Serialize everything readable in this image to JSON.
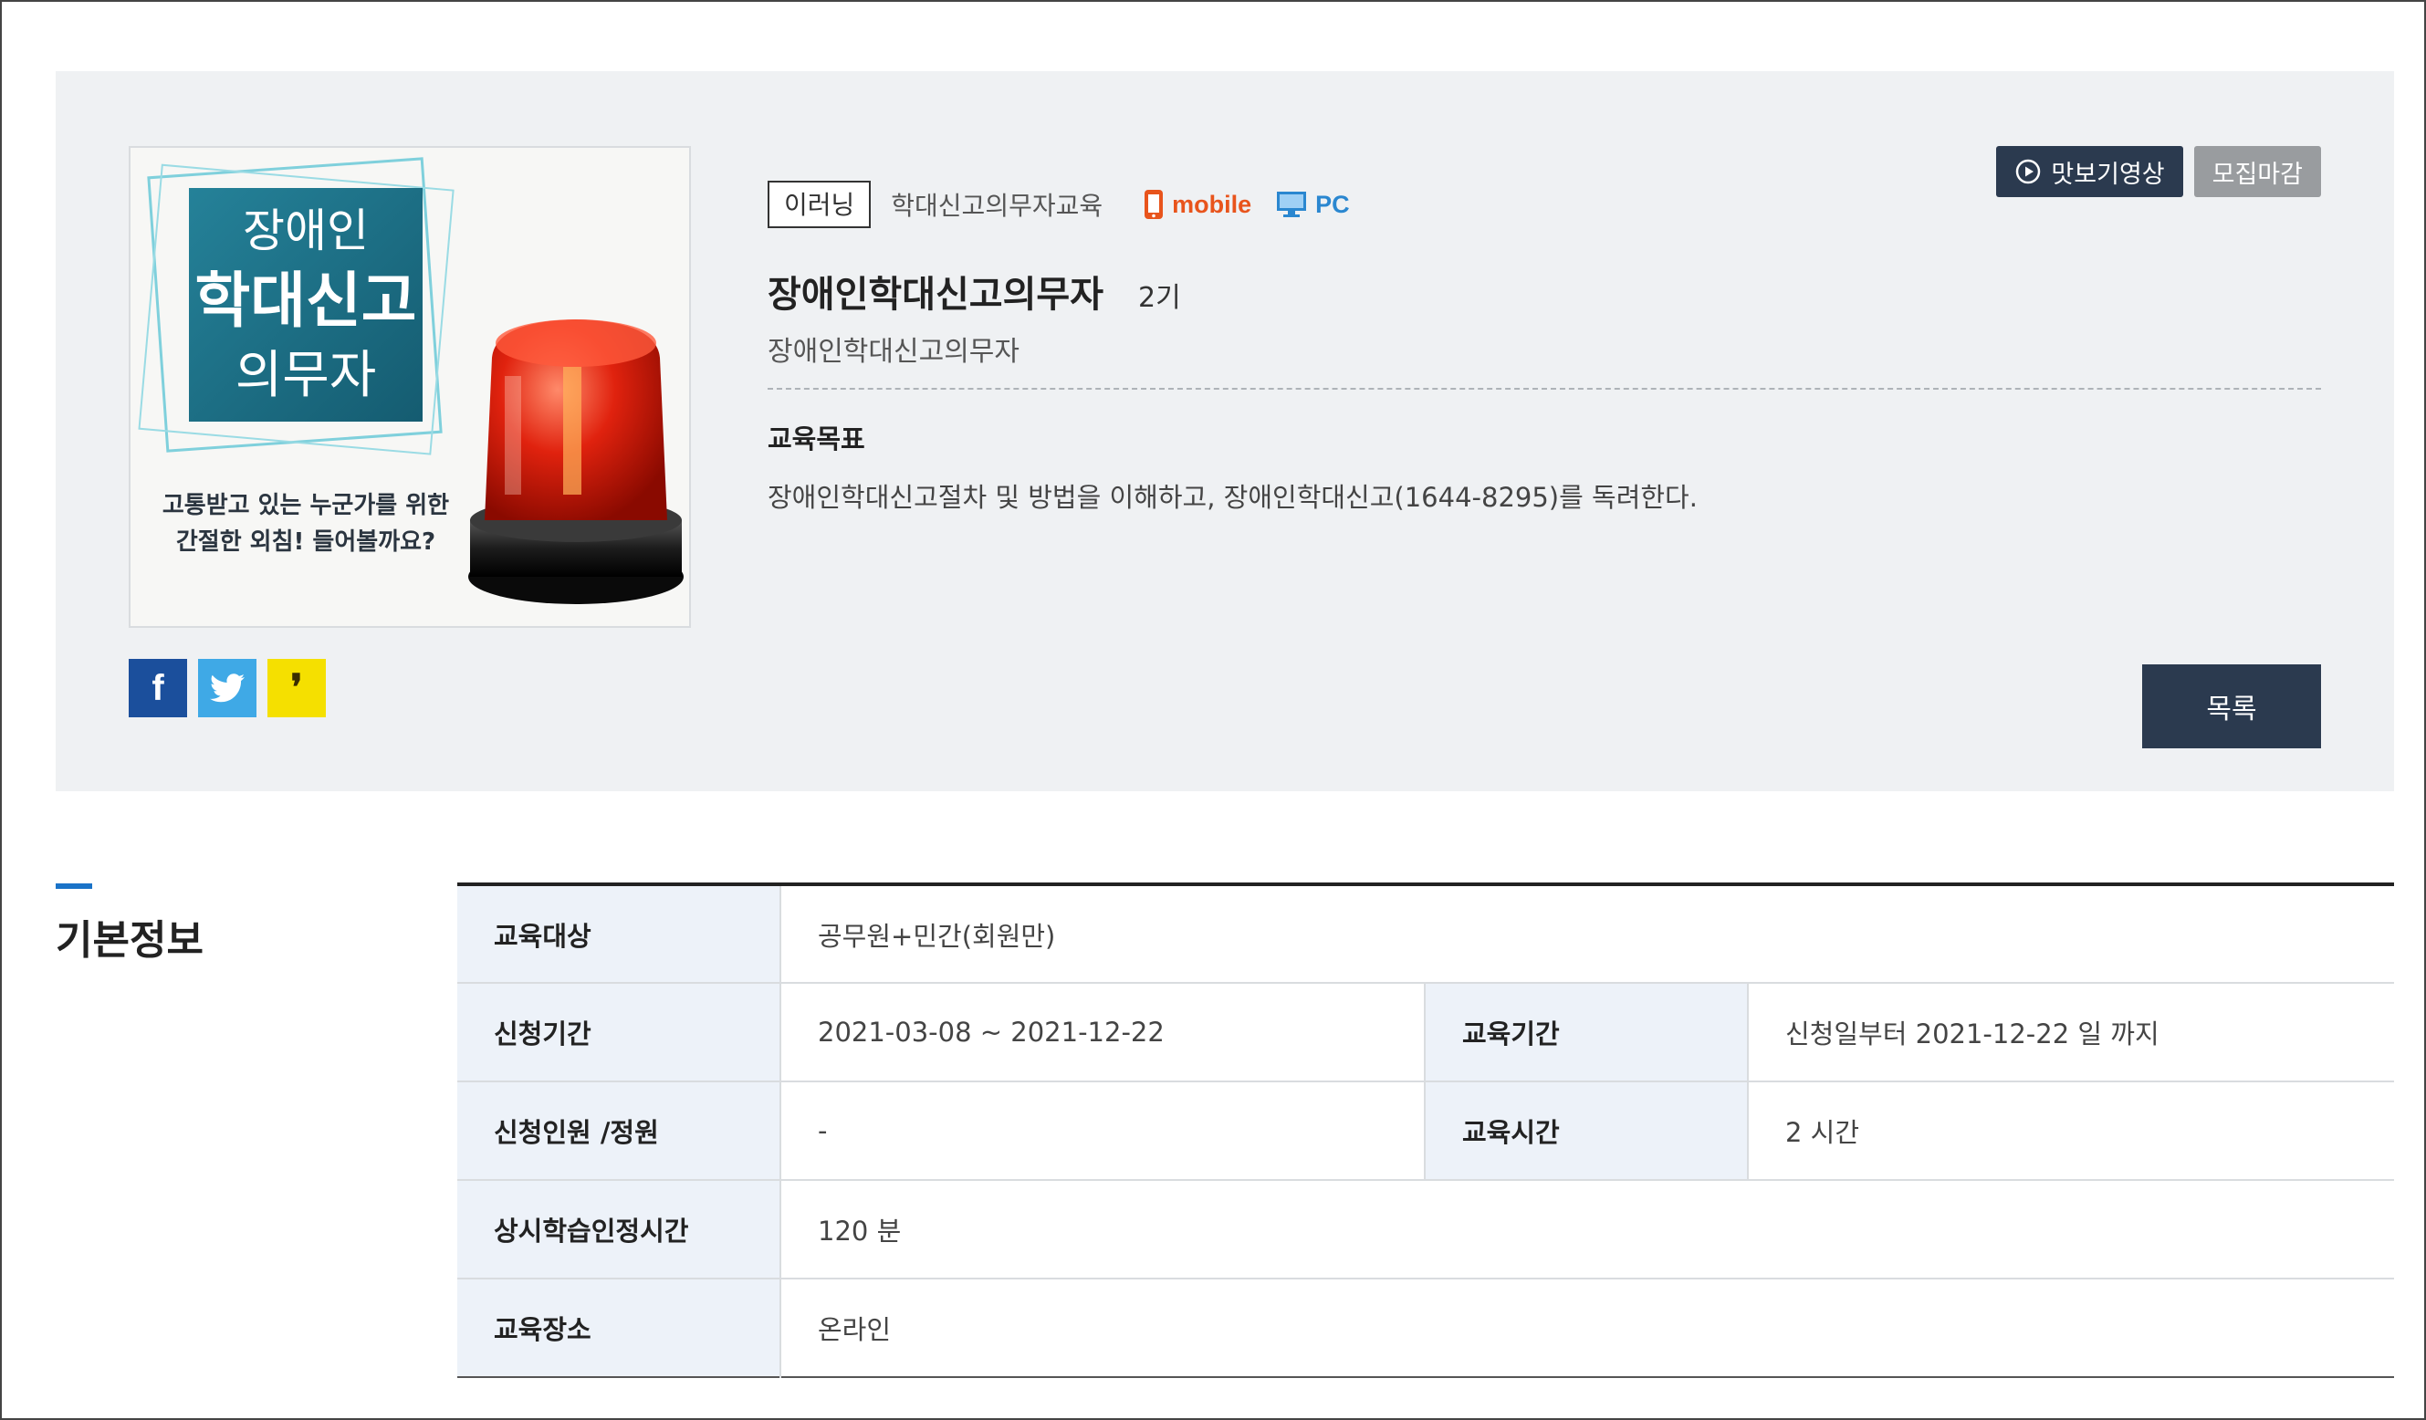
{
  "course": {
    "thumbnail": {
      "line1": "장애인",
      "line2": "학대신고",
      "line3": "의무자",
      "caption1": "고통받고 있는 누군가를 위한",
      "caption2": "간절한 외침! 들어볼까요?"
    },
    "tag": "이러닝",
    "category": "학대신고의무자교육",
    "devices": {
      "mobile": "mobile",
      "pc": "PC"
    },
    "title": "장애인학대신고의무자",
    "cohort": "2기",
    "subtitle": "장애인학대신고의무자",
    "goal_label": "교육목표",
    "goal_text": "장애인학대신고절차 및 방법을 이해하고, 장애인학대신고(1644-8295)를 독려한다.",
    "buttons": {
      "preview": "맛보기영상",
      "closed": "모집마감",
      "list": "목록"
    },
    "share": {
      "facebook": "f",
      "kakao": "❜"
    }
  },
  "basic_info": {
    "title": "기본정보",
    "target_label": "교육대상",
    "target_value": "공무원+민간(회원만)",
    "apply_period_label": "신청기간",
    "apply_period_value": "2021-03-08 ~ 2021-12-22",
    "edu_period_label": "교육기간",
    "edu_period_value": "신청일부터 2021-12-22 일 까지",
    "applicants_label": "신청인원 /정원",
    "applicants_value": "-",
    "edu_hours_label": "교육시간",
    "edu_hours_value": "2 시간",
    "credit_label": "상시학습인정시간",
    "credit_value": "120 분",
    "place_label": "교육장소",
    "place_value": "온라인"
  }
}
